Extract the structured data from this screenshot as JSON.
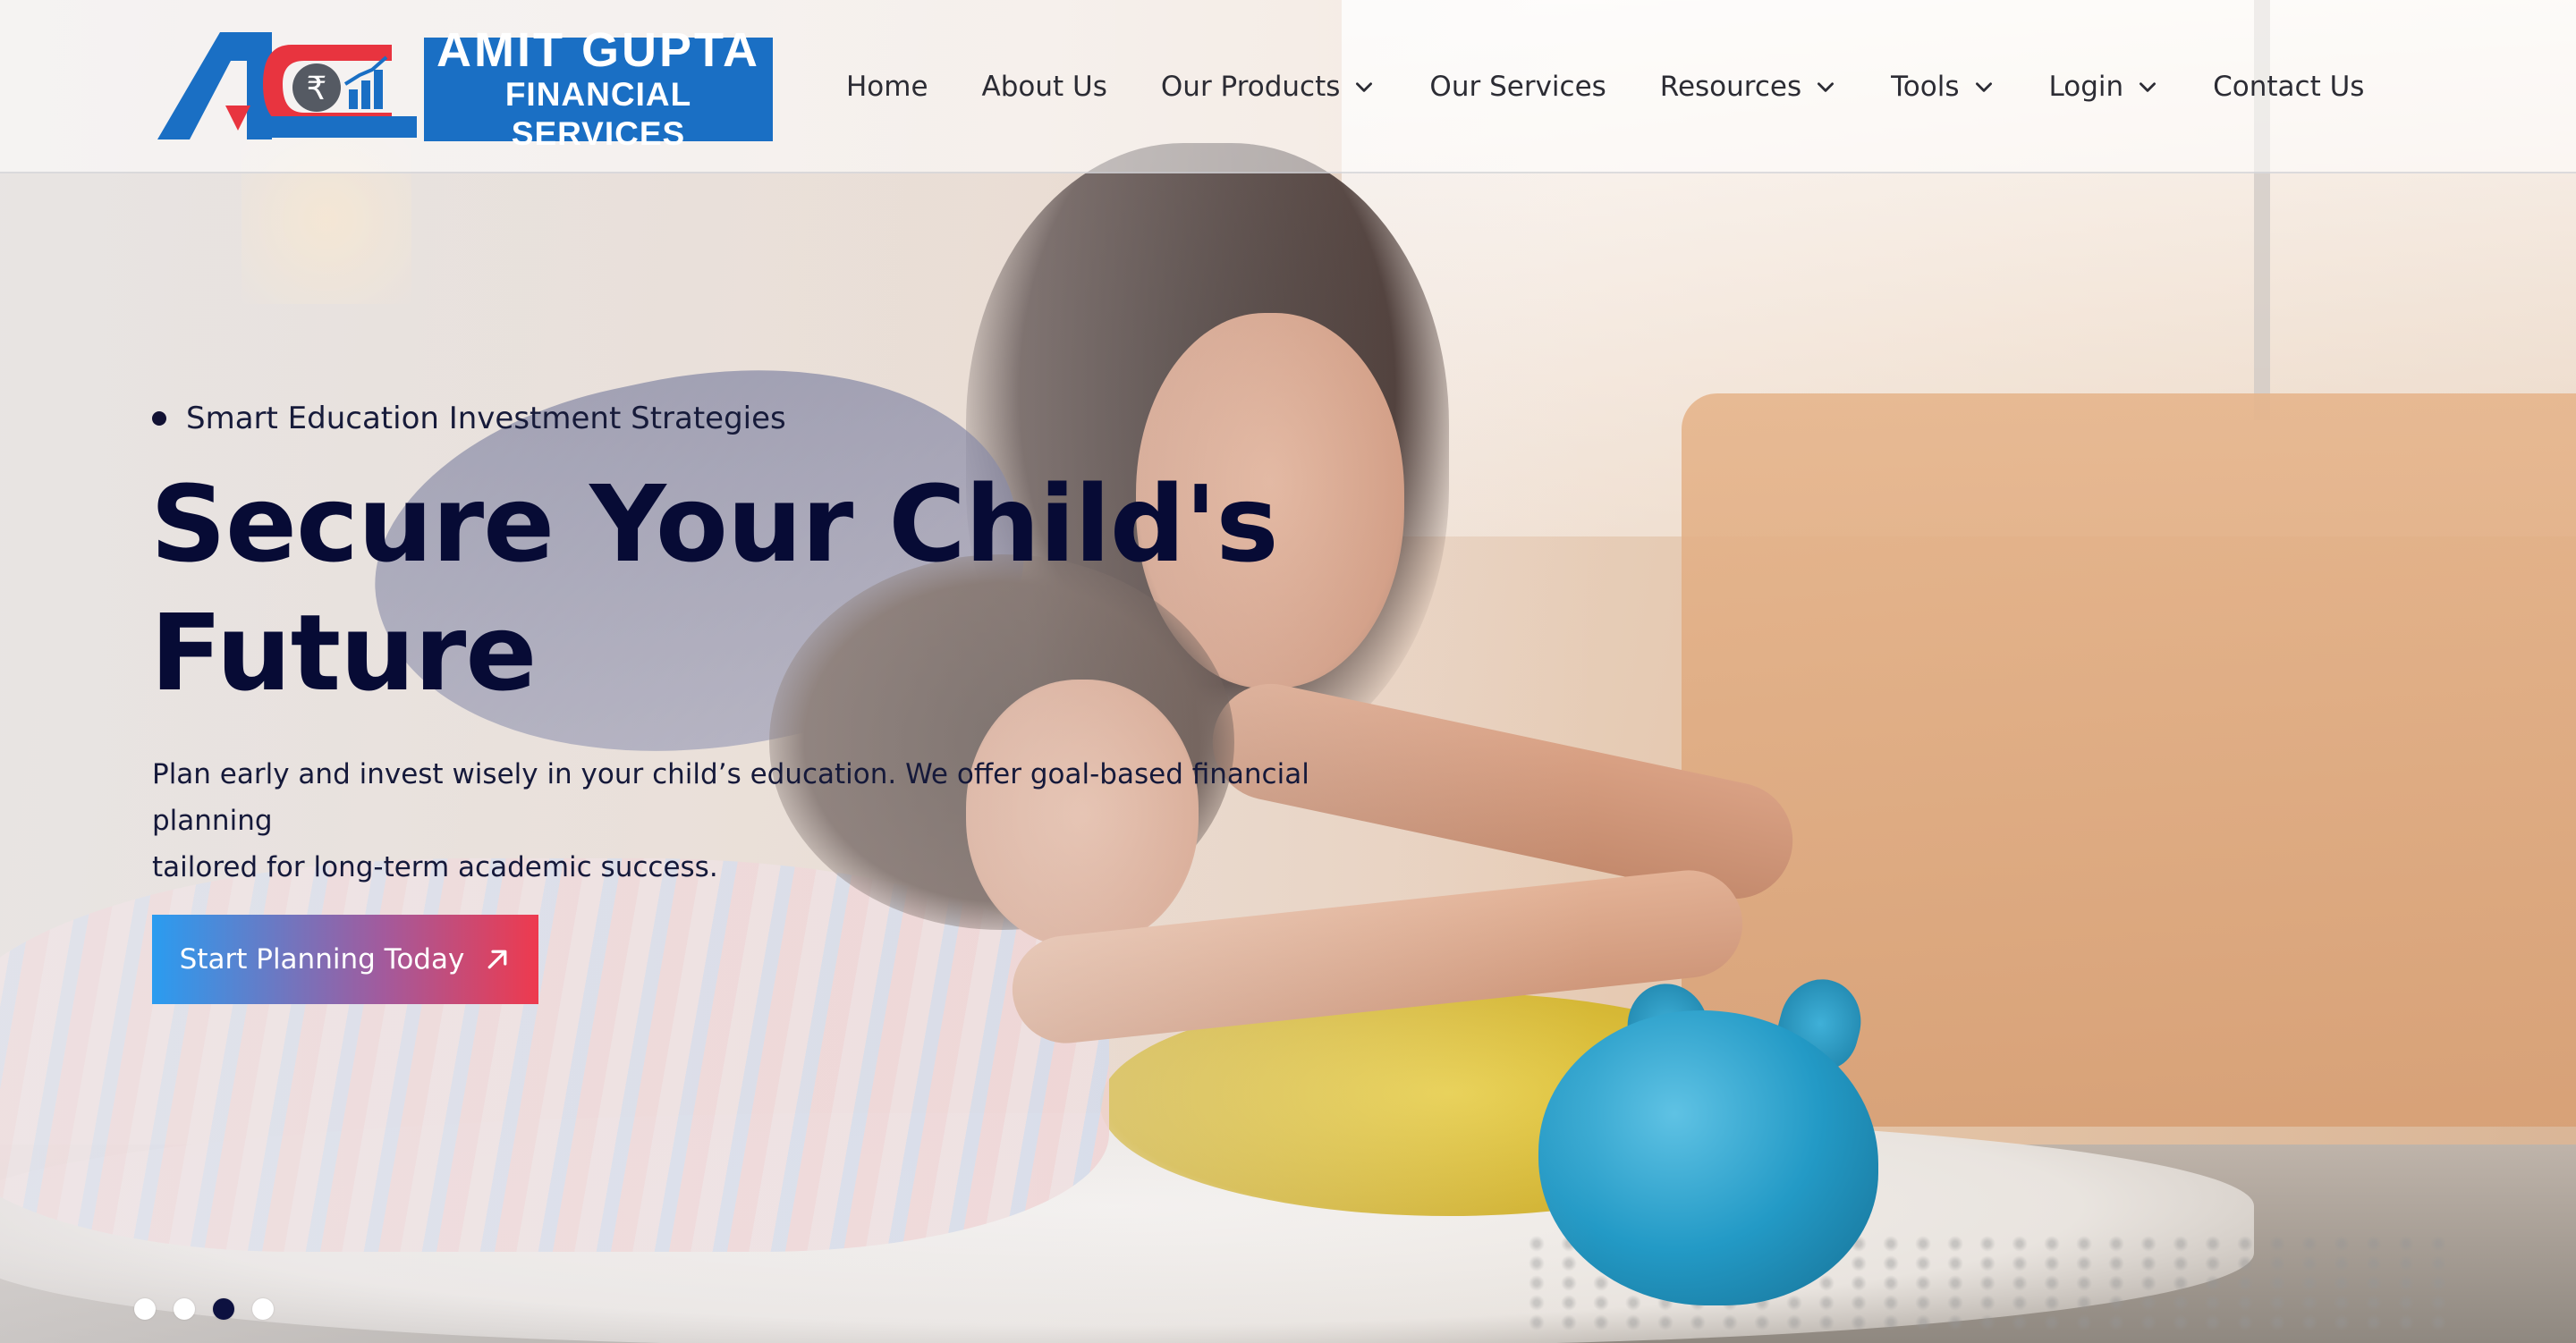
{
  "brand": {
    "line1": "AMIT GUPTA",
    "line2": "FINANCIAL SERVICES",
    "mark_icon": "rupee-chart-logo-icon",
    "colors": {
      "blue": "#1a6fc4",
      "red": "#e8343f"
    }
  },
  "nav": {
    "items": [
      {
        "label": "Home",
        "has_dropdown": false
      },
      {
        "label": "About Us",
        "has_dropdown": false
      },
      {
        "label": "Our Products",
        "has_dropdown": true
      },
      {
        "label": "Our Services",
        "has_dropdown": false
      },
      {
        "label": "Resources",
        "has_dropdown": true
      },
      {
        "label": "Tools",
        "has_dropdown": true
      },
      {
        "label": "Login",
        "has_dropdown": true
      },
      {
        "label": "Contact Us",
        "has_dropdown": false
      }
    ],
    "dropdown_icon": "chevron-down-icon"
  },
  "hero": {
    "eyebrow": "Smart Education Investment Strategies",
    "title_line1": "Secure Your Child's",
    "title_line2": "Future",
    "description_line1": "Plan early and invest wisely in your child’s education. We offer goal-based financial planning",
    "description_line2": "tailored for long-term academic success.",
    "cta_label": "Start Planning Today",
    "cta_icon": "arrow-up-right-icon",
    "cta_gradient": [
      "#2a9cf0",
      "#ee3a4e"
    ],
    "title_color": "#070b35"
  },
  "carousel": {
    "slide_count": 4,
    "active_index": 2
  }
}
